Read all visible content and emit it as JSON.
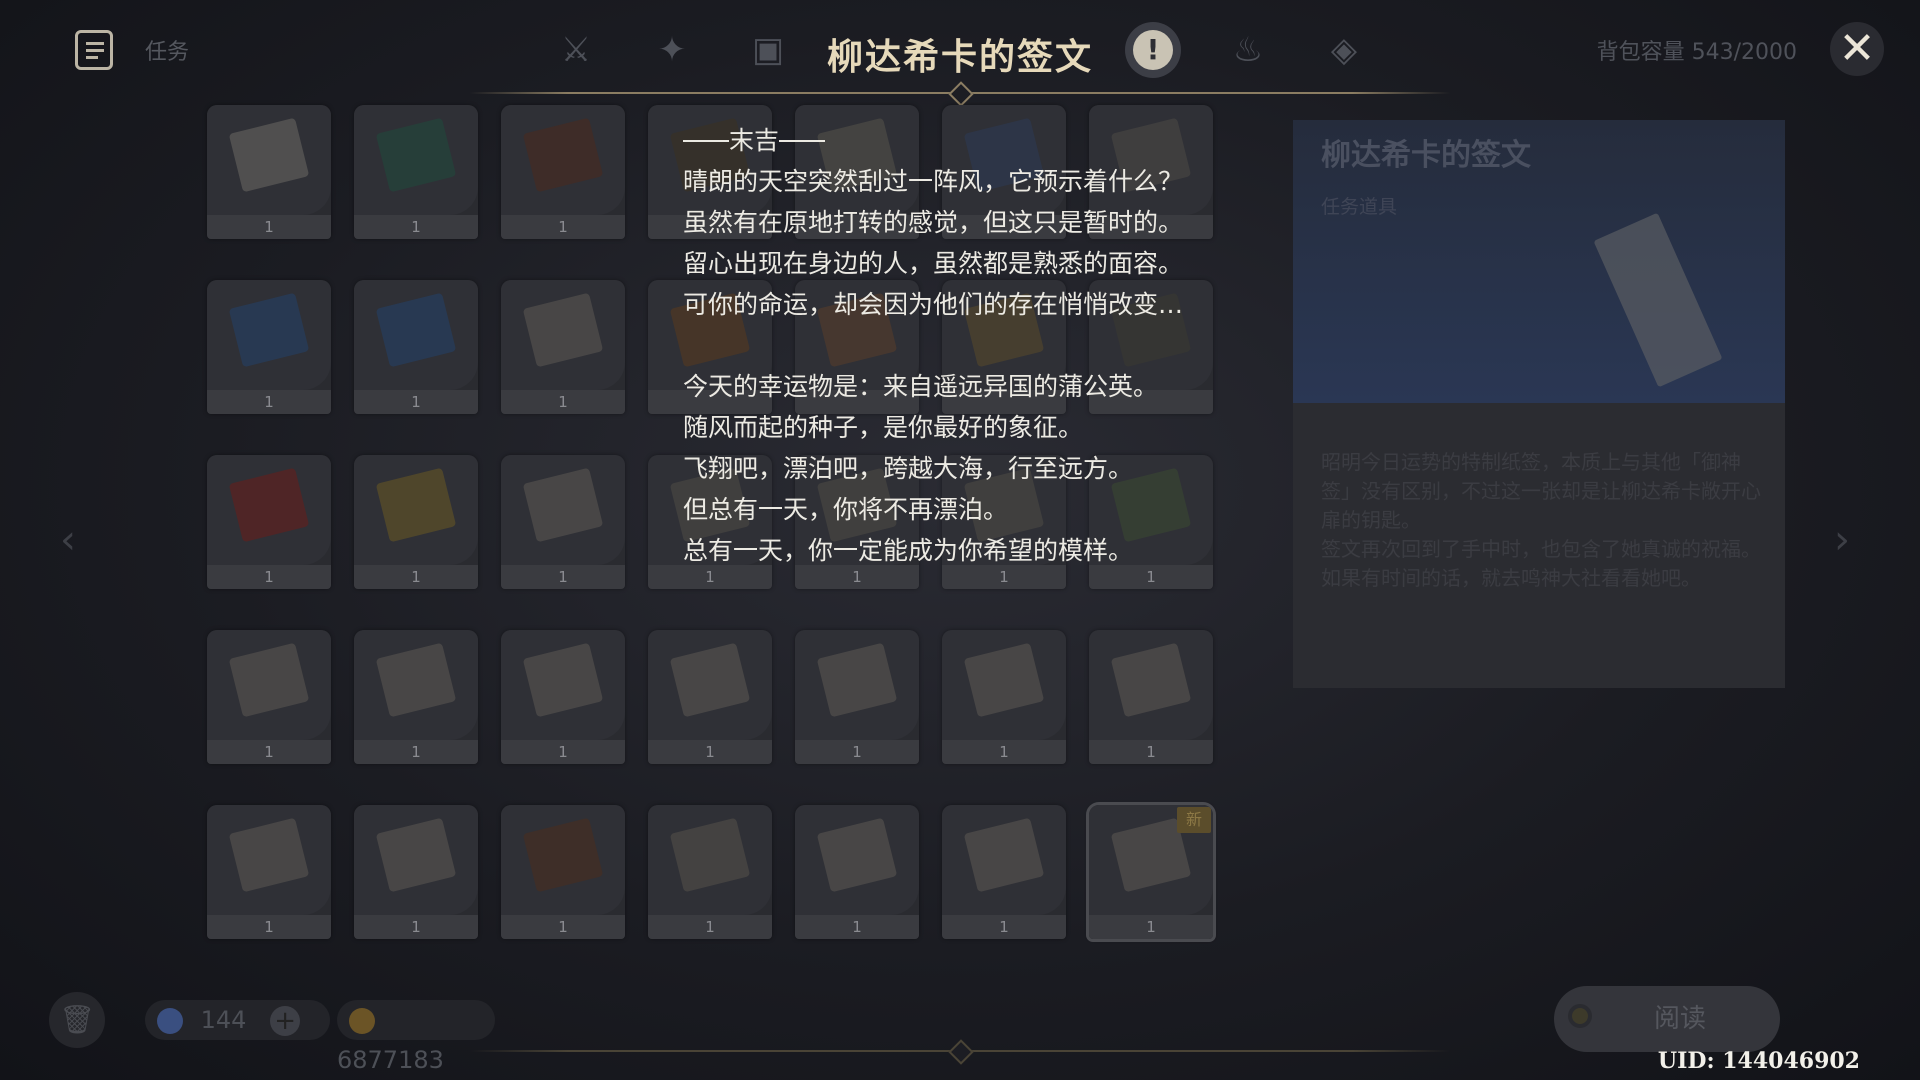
{
  "header": {
    "quest_label": "任务",
    "title": "柳达希卡的签文",
    "capacity": "背包容量 543/2000",
    "tabs": [
      {
        "icon": "weapon-icon"
      },
      {
        "icon": "artifact-icon"
      },
      {
        "icon": "character-card-icon"
      },
      {
        "icon": "quest-item-icon",
        "glyph": "!"
      },
      {
        "icon": "material-icon"
      },
      {
        "icon": "gadget-icon"
      }
    ]
  },
  "fortune": {
    "heading": "末吉",
    "lines": [
      "晴朗的天空突然刮过一阵风，它预示着什么？",
      "虽然有在原地打转的感觉，但这只是暂时的。",
      "留心出现在身边的人，虽然都是熟悉的面容。",
      "可你的命运，却会因为他们的存在悄悄改变…",
      "",
      "今天的幸运物是：来自遥远异国的蒲公英。",
      "随风而起的种子，是你最好的象征。",
      "飞翔吧，漂泊吧，跨越大海，行至远方。",
      "但总有一天，你将不再漂泊。",
      "总有一天，你一定能成为你希望的模样。"
    ]
  },
  "grid": {
    "items": [
      {
        "count": "1",
        "color": "#6b6a64"
      },
      {
        "count": "1",
        "color": "#1f4a3c"
      },
      {
        "count": "1",
        "color": "#4a2a1e"
      },
      {
        "count": "",
        "color": "#3a3220"
      },
      {
        "count": "",
        "color": "#55534a"
      },
      {
        "count": "",
        "color": "#2b3a55"
      },
      {
        "count": "",
        "color": "#4c4b46"
      },
      {
        "count": "1",
        "color": "#22426a"
      },
      {
        "count": "1",
        "color": "#22426a"
      },
      {
        "count": "1",
        "color": "#5c5a54"
      },
      {
        "count": "",
        "color": "#5a3a1e"
      },
      {
        "count": "",
        "color": "#5a3e2a"
      },
      {
        "count": "",
        "color": "#5a4a2a"
      },
      {
        "count": "",
        "color": "#3a3a32"
      },
      {
        "count": "1",
        "color": "#6a1e1a"
      },
      {
        "count": "1",
        "color": "#6a5a22"
      },
      {
        "count": "1",
        "color": "#5c5a54"
      },
      {
        "count": "1",
        "color": "#4e4c46"
      },
      {
        "count": "1",
        "color": "#4e4c46"
      },
      {
        "count": "1",
        "color": "#4e4c46"
      },
      {
        "count": "1",
        "color": "#3a4a32"
      },
      {
        "count": "1",
        "color": "#5c5a54"
      },
      {
        "count": "1",
        "color": "#5c5a54"
      },
      {
        "count": "1",
        "color": "#5c5a54"
      },
      {
        "count": "1",
        "color": "#5c5a54"
      },
      {
        "count": "1",
        "color": "#5c5a54"
      },
      {
        "count": "1",
        "color": "#5c5a54"
      },
      {
        "count": "1",
        "color": "#5c5a54"
      },
      {
        "count": "1",
        "color": "#5c5a54"
      },
      {
        "count": "1",
        "color": "#5c5a54"
      },
      {
        "count": "1",
        "color": "#4a2e1e"
      },
      {
        "count": "1",
        "color": "#55524a"
      },
      {
        "count": "1",
        "color": "#5c5a54"
      },
      {
        "count": "1",
        "color": "#5c5a54"
      },
      {
        "count": "1",
        "color": "#5c5a54",
        "selected": true,
        "badge": "新"
      }
    ]
  },
  "detail": {
    "name": "柳达希卡的签文",
    "type": "任务道具",
    "description": "昭明今日运势的特制纸签，本质上与其他「御神签」没有区别，不过这一张却是让柳达希卡敞开心扉的钥匙。\n签文再次回到了手中时，也包含了她真诚的祝福。如果有时间的话，就去鸣神大社看看她吧。"
  },
  "footer": {
    "primo_count": "144",
    "mora_count": "6877183",
    "read_label": "阅读",
    "uid": "UID: 144046902"
  },
  "colors": {
    "title": "#e6d9ba",
    "fortune_text": "#eceae3",
    "primo": "#4f6fb0",
    "mora": "#a88a3c"
  }
}
